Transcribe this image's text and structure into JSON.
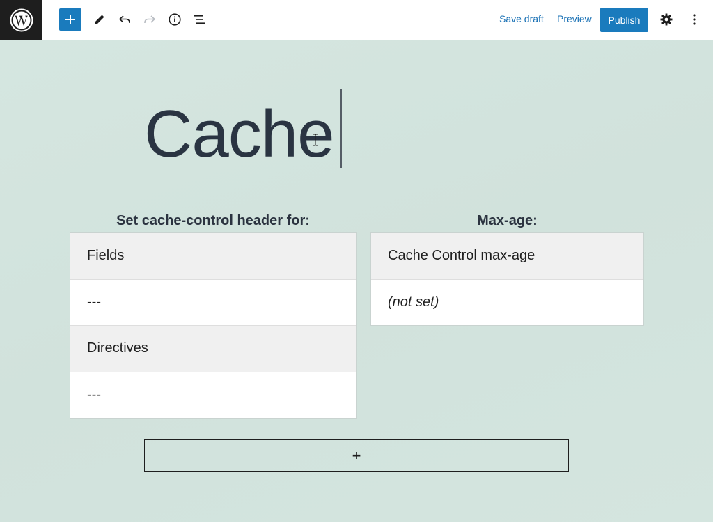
{
  "toolbar": {
    "save_draft": "Save draft",
    "preview": "Preview",
    "publish": "Publish",
    "icons": [
      "wordpress-logo-icon",
      "plus-icon",
      "pencil-icon",
      "undo-icon",
      "redo-icon",
      "info-icon",
      "list-view-icon",
      "gear-icon",
      "more-vertical-icon"
    ]
  },
  "post": {
    "title": "Cache"
  },
  "cache_control": {
    "heading": "Set cache-control header for:",
    "rows": [
      {
        "label": "Fields",
        "kind": "head"
      },
      {
        "label": "---",
        "kind": "value"
      },
      {
        "label": "Directives",
        "kind": "head"
      },
      {
        "label": "---",
        "kind": "value"
      }
    ]
  },
  "max_age": {
    "heading": "Max-age:",
    "rows": [
      {
        "label": "Cache Control max-age",
        "kind": "head"
      },
      {
        "label": "(not set)",
        "kind": "value"
      }
    ]
  },
  "appender": {
    "symbol": "+"
  },
  "colors": {
    "accent": "#1a7bbd",
    "canvas": "#d3e4de",
    "dark": "#1e1e1e"
  }
}
